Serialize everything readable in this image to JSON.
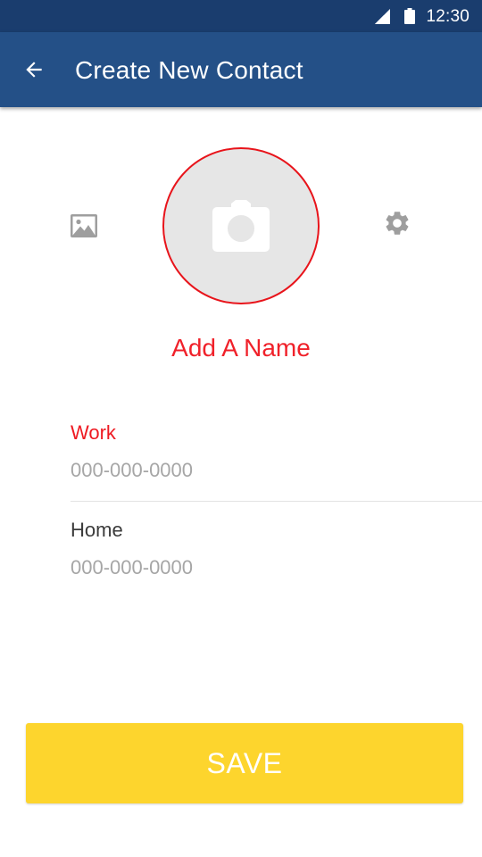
{
  "status_bar": {
    "time": "12:30",
    "icons": [
      "signal-icon",
      "battery-icon"
    ],
    "background": "#1a3d6e"
  },
  "app_bar": {
    "title": "Create New Contact",
    "back_icon": "arrow-back-icon",
    "background": "#245087"
  },
  "photo": {
    "left_icon": "image-icon",
    "center_icon": "camera-icon",
    "right_icon": "gear-icon",
    "circle_border_color": "#e8141b"
  },
  "name": {
    "label": "Add A Name",
    "color": "#f0212a"
  },
  "fields": {
    "work": {
      "label": "Work",
      "value": "",
      "placeholder": "000-000-0000",
      "label_color": "#ee1a22"
    },
    "home": {
      "label": "Home",
      "value": "",
      "placeholder": "000-000-0000",
      "label_color": "#3b3b3b"
    }
  },
  "save_button": {
    "label": "SAVE",
    "color": "#fdd52d"
  }
}
